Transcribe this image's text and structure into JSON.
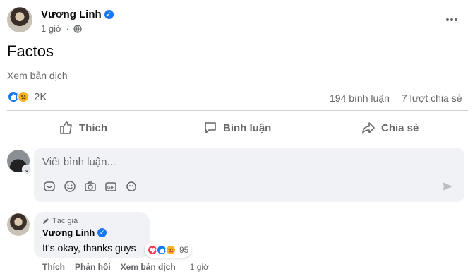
{
  "post": {
    "author": "Vương Linh",
    "time": "1 giờ",
    "text": "Factos",
    "translate": "Xem bản dịch",
    "reaction_count": "2K",
    "comment_count": "194 bình luận",
    "share_count": "7 lượt chia sẻ",
    "more_icon": "more-icon",
    "globe_icon": "globe-icon"
  },
  "actions": {
    "like": "Thích",
    "comment": "Bình luận",
    "share": "Chia sẻ"
  },
  "composer": {
    "placeholder": "Viết bình luận...",
    "icons": [
      "sticker-icon",
      "emoji-icon",
      "camera-icon",
      "gif-icon",
      "avatar-sticker-icon"
    ],
    "send_icon": "send-icon"
  },
  "comment": {
    "author_badge": "Tác giả",
    "author": "Vương Linh",
    "text": "It’s okay, thanks guys",
    "reaction_count": "95",
    "like": "Thích",
    "reply": "Phản hồi",
    "translate": "Xem bản dịch",
    "time": "1 giờ"
  },
  "colors": {
    "accent": "#1877f2",
    "muted": "#65676b",
    "surface": "#f0f2f5"
  }
}
